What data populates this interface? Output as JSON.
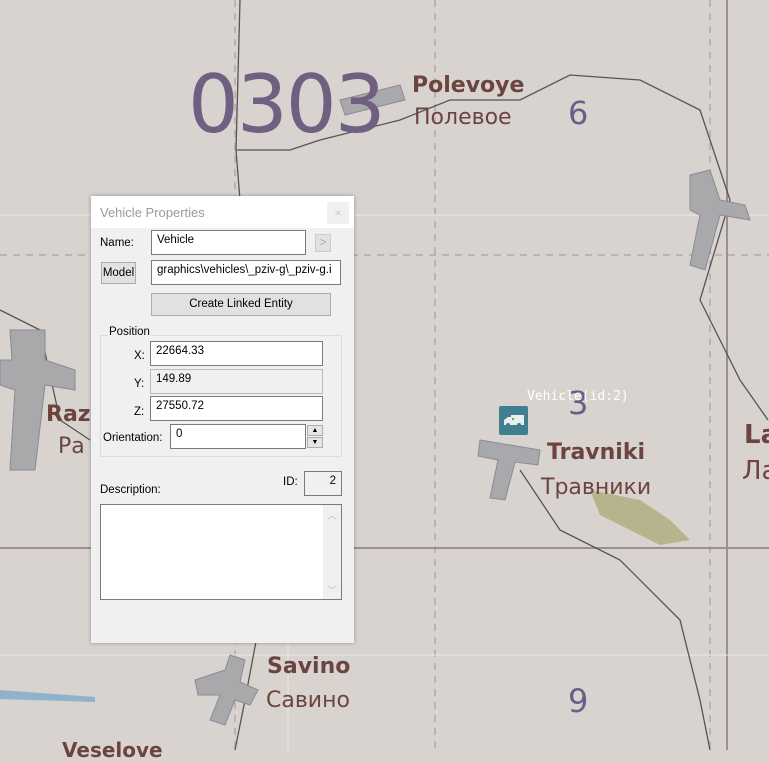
{
  "map": {
    "grid_label": "0303",
    "places": [
      {
        "latin": "Polevoye",
        "cyrillic": "Полевое"
      },
      {
        "latin": "Travniki",
        "cyrillic": "Травники"
      },
      {
        "latin": "Savino",
        "cyrillic": "Савино"
      },
      {
        "latin": "Raz",
        "cyrillic": "Ра"
      },
      {
        "latin": "La",
        "cyrillic": "Ла"
      },
      {
        "latin": "Veselove"
      }
    ],
    "sector_numbers": [
      "6",
      "3",
      "9"
    ]
  },
  "vehicle_marker": {
    "label": "Vehicle(id:2)",
    "icon": "truck-icon",
    "color": "#3f7f90"
  },
  "dialog": {
    "title": "Vehicle Properties",
    "close": "×",
    "name_label": "Name:",
    "name_value": "Vehicle",
    "arrow_button": ">",
    "model_button": "Model",
    "model_value": "graphics\\vehicles\\_pziv-g\\_pziv-g.i",
    "create_linked": "Create Linked Entity",
    "position_label": "Position",
    "x_label": "X:",
    "x_value": "22664.33",
    "y_label": "Y:",
    "y_value": "149.89",
    "z_label": "Z:",
    "z_value": "27550.72",
    "orientation_label": "Orientation:",
    "orientation_value": "0",
    "id_label": "ID:",
    "id_value": "2",
    "description_label": "Description:",
    "description_value": ""
  }
}
